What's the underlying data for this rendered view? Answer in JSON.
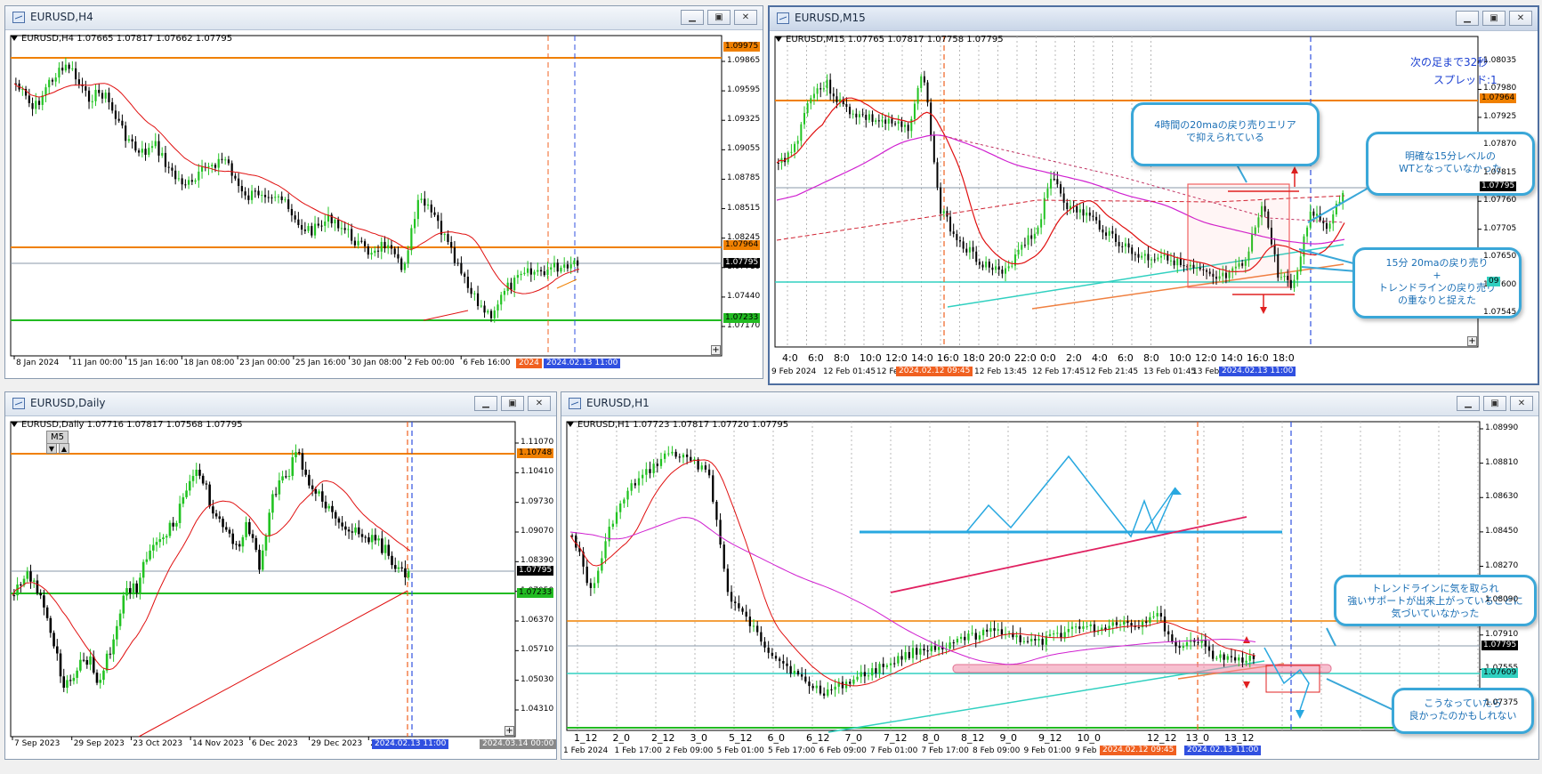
{
  "h4": {
    "title": "EURUSD,H4",
    "info": "EURUSD,H4  1.07665 1.07817 1.07662 1.07795",
    "prices": [
      "1.09865",
      "1.09595",
      "1.09325",
      "1.09055",
      "1.08785",
      "1.08515",
      "1.08245",
      "1.07710",
      "1.07440",
      "1.07170"
    ],
    "tags": {
      "orange_top": "1.09975",
      "orange_mid": "1.07964",
      "current": "1.07795",
      "green": "1.07233"
    },
    "times": [
      "8 Jan 2024",
      "11 Jan 00:00",
      "15 Jan 16:00",
      "18 Jan 08:00",
      "23 Jan 00:00",
      "25 Jan 16:00",
      "30 Jan 08:00",
      "2 Feb 00:00",
      "6 Feb 16:00"
    ],
    "time_tag_red": "2024",
    "time_tag_blue": "2024.02.13 11:00"
  },
  "m15": {
    "title": "EURUSD,M15",
    "info": "EURUSD,M15  1.07765 1.07817 1.07758 1.07795",
    "prices": [
      "1.08035",
      "1.07980",
      "1.07925",
      "1.07870",
      "1.07815",
      "1.07760",
      "1.07705",
      "1.07650",
      "1.07600",
      "1.07545"
    ],
    "tags": {
      "orange": "1.07964",
      "current": "1.07795",
      "cyan": "09"
    },
    "hours": [
      "4:0",
      "6:0",
      "8:0",
      "10:0",
      "12:0",
      "14:0",
      "16:0",
      "18:0",
      "20:0",
      "22:0",
      "0:0",
      "2:0",
      "4:0",
      "6:0",
      "8:0",
      "10:0",
      "12:0",
      "14:0",
      "16:0",
      "18:0"
    ],
    "times": [
      "9 Feb 2024",
      "12 Feb 01:45",
      "12 Feb",
      "3:45",
      "12 Feb 13:45",
      "12 Feb 17:45",
      "12 Feb 21:45",
      "13 Feb 01:45",
      "13 Feb 05:"
    ],
    "time_tag_red": "2024.02.12 09:45",
    "time_tag_blue": "2024.02.13 11:00",
    "next_bar": "次の足まで32秒",
    "spread": "スプレッド:1",
    "callout1": [
      "4時間の20maの戻り売りエリア",
      "で抑えられている"
    ],
    "callout2": [
      "明確な15分レベルの",
      "WTとなっていなかった"
    ],
    "callout3": [
      "15分 20maの戻り売り",
      "+",
      "トレンドラインの戻り売り",
      "の重なりと捉えた"
    ]
  },
  "daily": {
    "title": "EURUSD,Daily",
    "info": "EURUSD,Daily  1.07716 1.07817 1.07568 1.07795",
    "m5_label": "M5",
    "prices": [
      "1.11070",
      "1.10410",
      "1.09730",
      "1.09070",
      "1.08390",
      "1.07050",
      "1.06370",
      "1.05710",
      "1.05030",
      "1.04310"
    ],
    "tags": {
      "orange": "1.10748",
      "current": "1.07795",
      "green": "1.07233"
    },
    "times": [
      "7 Sep 2023",
      "29 Sep 2023",
      "23 Oct 2023",
      "14 Nov 2023",
      "6 Dec 2023",
      "29 Dec 2023",
      "23 J"
    ],
    "time_tag_blue": "2024.02.13 11:00",
    "time_tag_gray": "2024.03.14 00:00"
  },
  "h1": {
    "title": "EURUSD,H1",
    "info": "EURUSD,H1  1.07723 1.07817 1.07720 1.07795",
    "prices": [
      "1.08990",
      "1.08810",
      "1.08630",
      "1.08450",
      "1.08270",
      "1.08090",
      "1.07910",
      "1.07555",
      "1.07375"
    ],
    "tags": {
      "current": "1.07795",
      "cyan": "1.07609"
    },
    "days": [
      "1_12",
      "2_0",
      "2_12",
      "3_0",
      "5_12",
      "6_0",
      "6_12",
      "7_0",
      "7_12",
      "8_0",
      "8_12",
      "9_0",
      "9_12",
      "10_0",
      "12_12",
      "13_0",
      "13_12"
    ],
    "times": [
      "1 Feb 2024",
      "1 Feb 17:00",
      "2 Feb 09:00",
      "5 Feb 01:00",
      "5 Feb 17:00",
      "6 Feb 09:00",
      "7 Feb 01:00",
      "7 Feb 17:00",
      "8 Feb 09:00",
      "9 Feb 01:00",
      "9 Feb 1"
    ],
    "time_tag_red": "2024.02.12 09:45",
    "time_tag_blue": "2024.02.13 11:00",
    "callout1": [
      "トレンドラインに気を取られ",
      "強いサポートが出来上がっていることに",
      "気づいていなかった"
    ],
    "callout2": [
      "こうなっていたら",
      "良かったのかもしれない"
    ]
  },
  "colors": {
    "bull": "#22c322",
    "bear": "#000000",
    "ma_red": "#e01010",
    "ma_mag": "#d020d0",
    "orange": "#f08000",
    "green_line": "#22bb22",
    "cyan": "#30d0c0",
    "callout_border": "#3aa7d8"
  }
}
